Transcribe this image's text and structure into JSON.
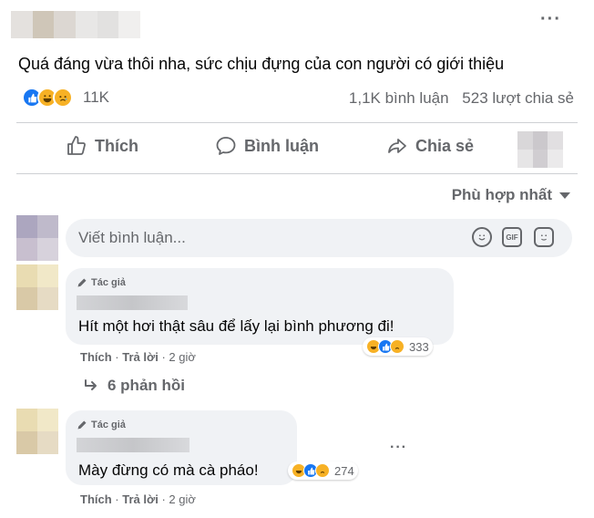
{
  "post": {
    "text": "Quá đáng vừa thôi nha, sức chịu đựng của con người có giới thiệu",
    "more_icon": "···",
    "reaction_count": "11K",
    "comment_count": "1,1K bình luận",
    "share_count": "523 lượt chia sẻ"
  },
  "actions": {
    "like": "Thích",
    "comment": "Bình luận",
    "share": "Chia sẻ"
  },
  "sort": {
    "label": "Phù hợp nhất"
  },
  "comment_input": {
    "placeholder": "Viết bình luận...",
    "gif_label": "GIF"
  },
  "comments": [
    {
      "author_tag": "Tác giả",
      "text": "Hít một hơi thật sâu để lấy lại bình phương đi!",
      "reaction_count": "333",
      "like_label": "Thích",
      "reply_label": "Trả lời",
      "time": "2 giờ",
      "replies": "6 phản hồi"
    },
    {
      "author_tag": "Tác giả",
      "text": "Mày đừng có mà cà pháo!",
      "reaction_count": "274",
      "like_label": "Thích",
      "reply_label": "Trả lời",
      "time": "2 giờ",
      "more_icon": "···"
    }
  ],
  "colors": {
    "facebook_blue": "#1877f2",
    "reaction_yellow": "#f7b125",
    "secondary_text": "#65676b",
    "bubble_bg": "#f0f2f5"
  }
}
